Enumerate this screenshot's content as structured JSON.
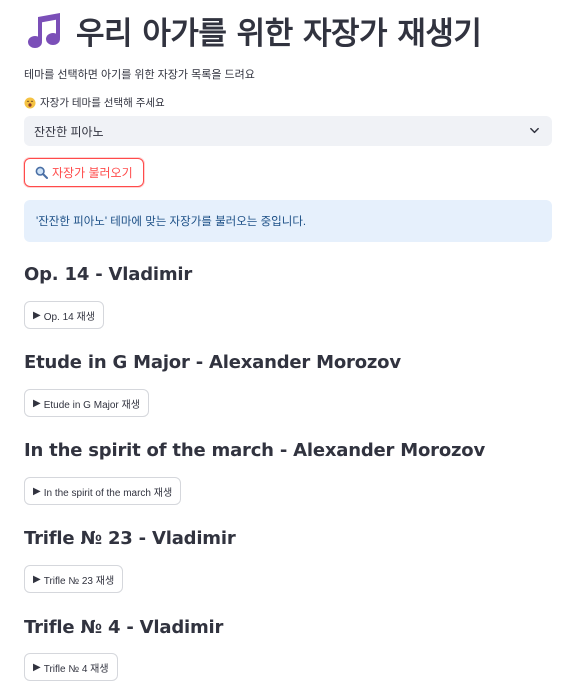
{
  "header": {
    "title": "우리 아가를 위한 자장가 재생기",
    "subtitle": "테마를 선택하면 아기를 위한 자장가 목록을 드려요"
  },
  "theme_select": {
    "label": "자장가 테마를 선택해 주세요",
    "value": "잔잔한 피아노"
  },
  "load_button": {
    "label": "자장가 불러오기"
  },
  "info": {
    "message": "'잔잔한 피아노' 테마에 맞는 자장가를 불러오는 중입니다."
  },
  "tracks": [
    {
      "title": "Op. 14 - Vladimir",
      "play_label": "Op. 14 재생"
    },
    {
      "title": "Etude in G Major - Alexander Morozov",
      "play_label": "Etude in G Major 재생"
    },
    {
      "title": "In the spirit of the march - Alexander Morozov",
      "play_label": "In the spirit of the march 재생"
    },
    {
      "title": "Trifle № 23 - Vladimir",
      "play_label": "Trifle № 23 재생"
    },
    {
      "title": "Trifle № 4 - Vladimir",
      "play_label": "Trifle № 4 재생"
    }
  ],
  "colors": {
    "accent": "#ff4b4b",
    "info_bg": "#e6f0fc",
    "info_text": "#1c4f86",
    "select_bg": "#f0f2f6"
  },
  "icons": {
    "title": "music-notes-icon",
    "label": "yawning-face-icon",
    "button": "magnifier-icon",
    "play": "play-triangle-icon"
  }
}
